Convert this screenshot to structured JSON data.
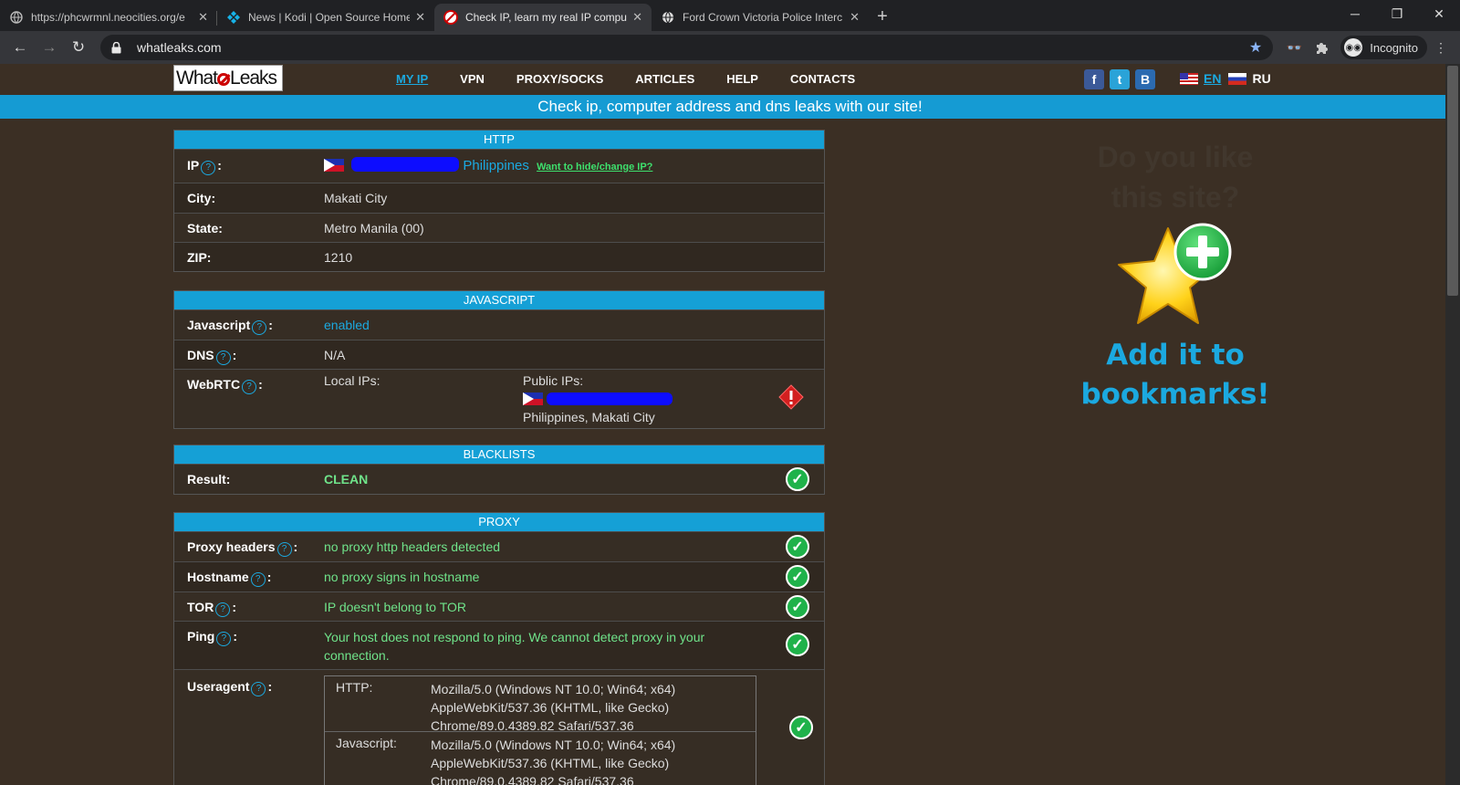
{
  "browser": {
    "tabs": [
      {
        "title": "https://phcwrmnl.neocities.org/e",
        "favicon": "globe-icon",
        "active": false
      },
      {
        "title": "News | Kodi | Open Source Home",
        "favicon": "kodi-icon",
        "active": false
      },
      {
        "title": "Check IP, learn my real IP compu",
        "favicon": "whatleaks-icon",
        "active": true
      },
      {
        "title": "Ford Crown Victoria Police Interc",
        "favicon": "globe-icon",
        "active": false
      }
    ],
    "url": "whatleaks.com",
    "profile_label": "Incognito"
  },
  "site": {
    "logo": {
      "left": "What",
      "right": "Leaks"
    },
    "menu": [
      {
        "label": "MY IP",
        "active": true
      },
      {
        "label": "VPN"
      },
      {
        "label": "PROXY/SOCKS"
      },
      {
        "label": "ARTICLES"
      },
      {
        "label": "HELP"
      },
      {
        "label": "CONTACTS"
      }
    ],
    "social": [
      "f",
      "t",
      "B"
    ],
    "lang_en": "EN",
    "lang_ru": "RU",
    "banner": "Check ip, computer address and dns leaks with our site!"
  },
  "http": {
    "title": "HTTP",
    "ip_label": "IP",
    "ip_country": "Philippines",
    "ip_link": "Want to hide/change IP?",
    "city_label": "City:",
    "city": "Makati City",
    "state_label": "State:",
    "state": "Metro Manila (00)",
    "zip_label": "ZIP:",
    "zip": "1210"
  },
  "javascript": {
    "title": "JAVASCRIPT",
    "js_label": "Javascript",
    "js_value": "enabled",
    "dns_label": "DNS",
    "dns_value": "N/A",
    "webrtc_label": "WebRTC",
    "local_ips_label": "Local IPs:",
    "public_ips_label": "Public IPs:",
    "public_location": "Philippines, Makati City"
  },
  "blacklists": {
    "title": "BLACKLISTS",
    "result_label": "Result:",
    "result_value": "CLEAN"
  },
  "proxy": {
    "title": "PROXY",
    "headers_label": "Proxy headers",
    "headers_value": "no proxy http headers detected",
    "hostname_label": "Hostname",
    "hostname_value": "no proxy signs in hostname",
    "tor_label": "TOR",
    "tor_value": "IP doesn't belong to TOR",
    "ping_label": "Ping",
    "ping_value": "Your host does not respond to ping. We cannot detect proxy in your connection.",
    "ua_label": "Useragent",
    "ua_http_label": "HTTP:",
    "ua_http_value": "Mozilla/5.0 (Windows NT 10.0; Win64; x64) AppleWebKit/537.36 (KHTML, like Gecko) Chrome/89.0.4389.82 Safari/537.36",
    "ua_js_label": "Javascript:",
    "ua_js_value": "Mozilla/5.0 (Windows NT 10.0; Win64; x64) AppleWebKit/537.36 (KHTML, like Gecko) Chrome/89.0.4389.82 Safari/537.36"
  },
  "promo": {
    "ghost_text": "Do you like this site?",
    "add_text": "Add it to bookmarks!"
  }
}
